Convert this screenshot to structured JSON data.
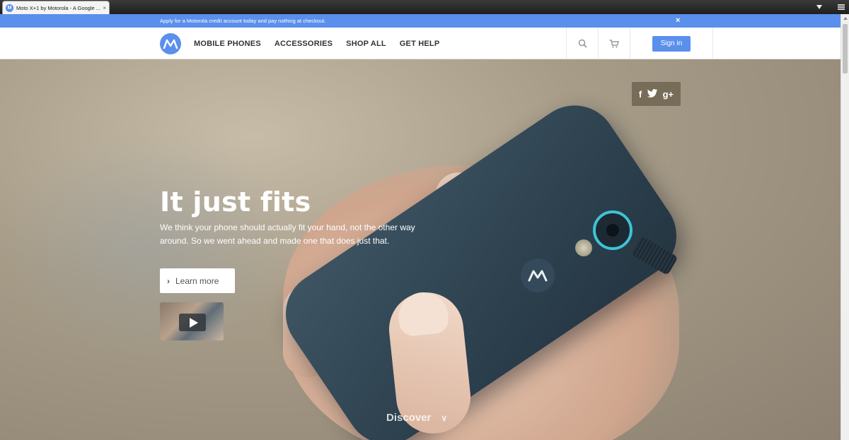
{
  "browser": {
    "tab_title": "Moto X+1 by Motorola - A Google ...",
    "tab_close": "×"
  },
  "promo": {
    "text": "Apply for a Motorola credit account today and pay nothing at checkout.",
    "close": "×"
  },
  "nav": {
    "links": [
      "MOBILE PHONES",
      "ACCESSORIES",
      "SHOP ALL",
      "GET HELP"
    ],
    "signin_label": "Sign in",
    "brand_color": "#5b8fec"
  },
  "social": {
    "facebook": "f",
    "twitter": "🐦",
    "google_plus": "g+"
  },
  "hero": {
    "headline": "It just fits",
    "subhead": "We think your phone should actually fit your hand, not the other way around. So we went ahead and made one that does just that.",
    "learn_more": "Learn more",
    "discover": "Discover"
  },
  "icons": {
    "search": "search-icon",
    "cart": "cart-icon",
    "play": "play-icon",
    "chevron_right": "chevron-right-icon",
    "chevron_down": "chevron-down-icon"
  }
}
